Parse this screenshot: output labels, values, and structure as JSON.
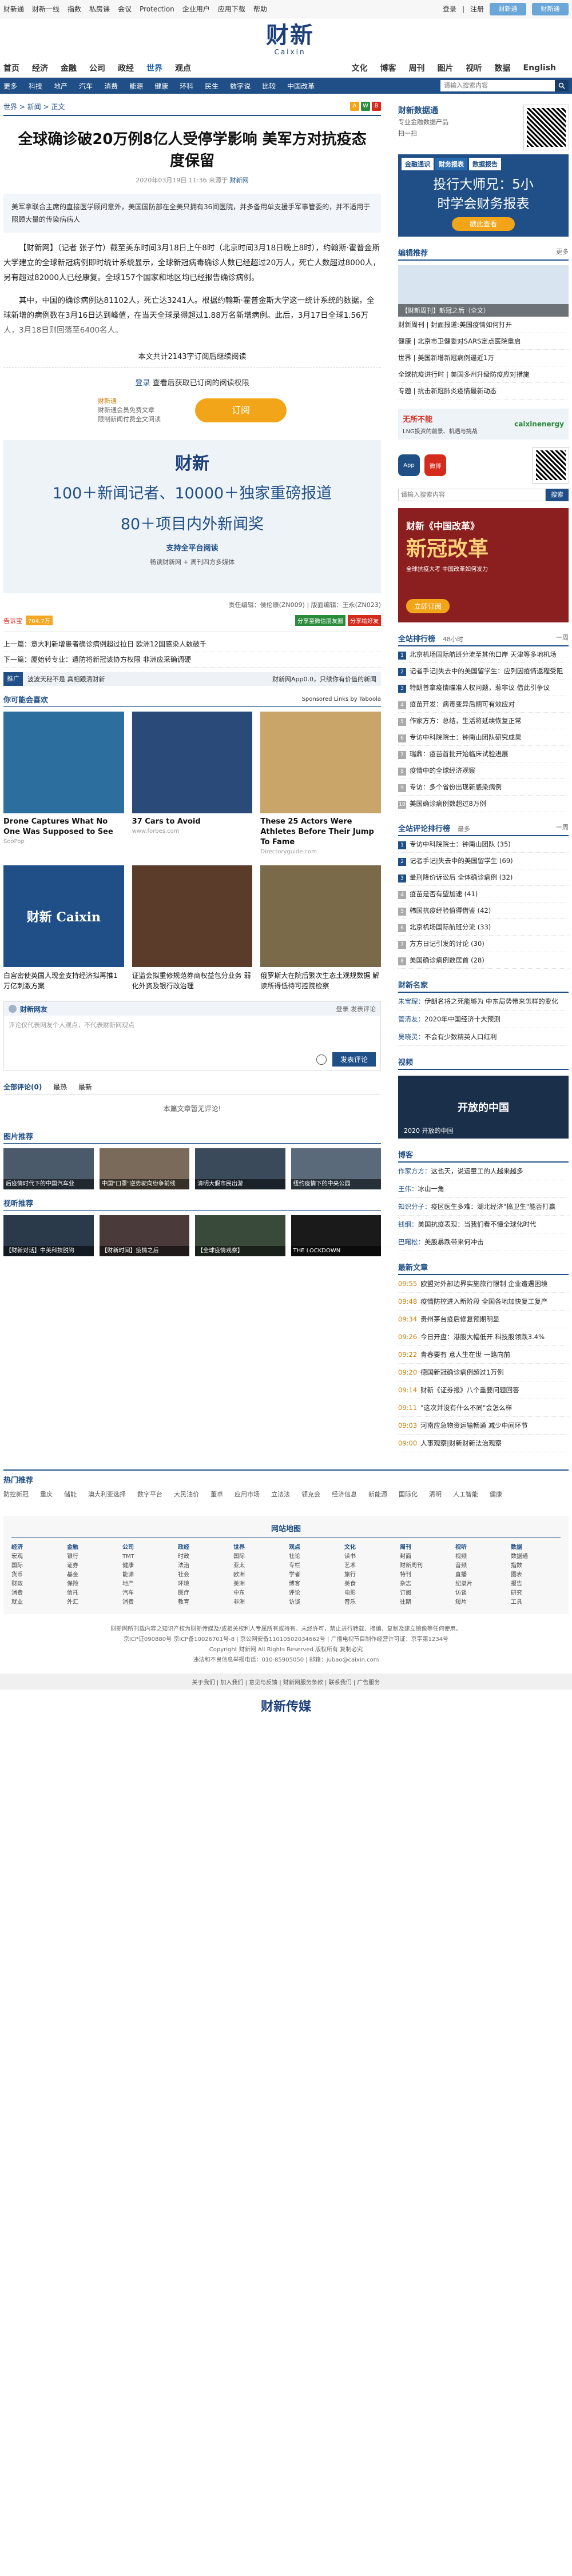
{
  "util": {
    "left": [
      "财新通",
      "财新一线",
      "指数",
      "私房课",
      "会议",
      "Protection",
      "企业用户",
      "应用下载",
      "帮助"
    ],
    "login": "登录",
    "register": "注册",
    "btn1": "财新通",
    "btn2": "财新通"
  },
  "logo": {
    "cn": "财新",
    "en": "Caixin"
  },
  "nav1": [
    "首页",
    "经济",
    "金融",
    "公司",
    "政经",
    "世界",
    "观点",
    "文化",
    "博客",
    "周刊",
    "图片",
    "视听",
    "数据",
    "English"
  ],
  "nav1_current": "世界",
  "nav2": [
    "更多",
    "科技",
    "地产",
    "汽车",
    "消费",
    "能源",
    "健康",
    "环科",
    "民生",
    "数字说",
    "比较",
    "中国改革"
  ],
  "search_placeholder": "请输入搜索内容",
  "crumb": "世界 > 新闻 > 正文",
  "title": "全球确诊破20万例8亿人受停学影响 美军方对抗疫态度保留",
  "meta": {
    "date": "2020年03月19日 11:36 来源于",
    "source": "财新网"
  },
  "summary": "美军拿联合主席的直接医学顾问意外，美国国防部在全美只拥有36间医院，并多备用单支援手军事管委的，并不适用于照顾大量的传染病病人",
  "body": [
    "【财新网】（记者 张子竹）截至美东时间3月18日上午8时（北京时间3月18日晚上8时），约翰斯·霍普金斯大学建立的全球新冠病例即时统计系统显示，全球新冠病毒确诊人数已经超过20万人，死亡人数超过8000人，另有超过82000人已经康复。全球157个国家和地区均已经报告确诊病例。",
    "其中，中国的确诊病例达81102人，死亡达3241人。根据约翰斯·霍普金斯大学这一统计系统的数据，全球新增的病例数在3月16日达到峰值，在当天全球录得超过1.88万名新增病例。此后，3月17日全球1.56万人，3月18日则回落至6400名人。"
  ],
  "sub_note": "本文共计2143字订阅后继续阅读",
  "login_line": {
    "link": "登录",
    "text": "查看后获取已订阅的阅读权限"
  },
  "sub_text": {
    "l1": "财新通会员免费文章",
    "l2": "限制新闻付费全文阅读",
    "em": "财新通"
  },
  "sub_button": "订阅",
  "promo": {
    "logo": "财新",
    "l1a": "100＋新闻记者、10000＋独家重磅报道",
    "l1b": "80＋项目内外新闻奖",
    "l2": "支持全平台阅读",
    "l3": "畅读财新网 + 周刊四方多媒体"
  },
  "editors": "责任编辑：侯伦康(ZN009) | 版面编辑：王永(ZN023)",
  "share": {
    "weibo": "告诉宝",
    "count": "704.7万",
    "b1": "分享至微信朋友圈",
    "b2": "分享给好友"
  },
  "prev": {
    "label": "上一篇：",
    "text": "意大利新增患者确诊病例超过拉日 欧洲12国感染人数破千"
  },
  "next": {
    "label": "下一篇：",
    "text": "厦始转专业：遣防将新冠该协方权限 非洲应采确调硬"
  },
  "adline": {
    "tag": "推广",
    "text": "波波天秘不是 真相跟清财新",
    "right": "财新网App0.0，只续你有价值的新闻"
  },
  "taboola": {
    "header": "你可能会喜欢",
    "right": "Sponsored Links by Taboola",
    "cards": [
      {
        "title": "Drone Captures What No One Was Supposed to See",
        "src": "SooPop",
        "bg": "#2c6e9e",
        "txt": ""
      },
      {
        "title": "37 Cars to Avoid",
        "src": "www.forbes.com",
        "bg": "#2a4b7a",
        "txt": ""
      },
      {
        "title": "These 25 Actors Were Athletes Before Their Jump To Fame",
        "src": "Directoryguide.com",
        "bg": "#c9a56a",
        "txt": ""
      },
      {
        "title": "白宫密使英国人现金支持经济拟再推1万亿刺激方案",
        "src": "",
        "bg": "#1f4f86",
        "txt": "财新 Caixin"
      },
      {
        "title": "证监会拟重修规范券商权益包分业务 弱化外资及银行改治理",
        "src": "",
        "bg": "#5b3b2a",
        "txt": ""
      },
      {
        "title": "俄罗斯大在院后繁次生态土观规数据 解读所得低待可控院检察",
        "src": "",
        "bg": "#7a6a4a",
        "txt": ""
      }
    ]
  },
  "comment": {
    "head": "财新网友",
    "login": "登录 发表评论",
    "placeholder": "评论仅代表网友个人观点，不代表财新网观点",
    "send": "发表评论",
    "tabs": [
      "全部评论(0)",
      "最热",
      "最新"
    ],
    "empty": "本篇文章暂无评论!"
  },
  "pic_recommend": {
    "header": "图片推荐",
    "items": [
      {
        "cap": "后疫情时代下的中国汽车业",
        "bg": "#4a5a6a"
      },
      {
        "cap": "中国\"口罩\"逆势驶向纷争前线",
        "bg": "#7a6a5a"
      },
      {
        "cap": "清明大假市民出游",
        "bg": "#3a4a5a"
      },
      {
        "cap": "纽约疫情下的中央公园",
        "bg": "#5a6a7a"
      }
    ]
  },
  "video_recommend": {
    "header": "视听推荐",
    "items": [
      {
        "cap": "【财新对话】中美科技脱钩",
        "bg": "#2a3a4a"
      },
      {
        "cap": "【财新时间】疫情之后",
        "bg": "#4a3a3a"
      },
      {
        "cap": "【全球疫情观察】",
        "bg": "#3a4a3a"
      },
      {
        "cap": "THE LOCKDOWN",
        "bg": "#1a1a1a"
      }
    ]
  },
  "side": {
    "top_ad": {
      "t1": "财新数据通",
      "t2": "专业金融数据产品",
      "qr_note": "扫一扫"
    },
    "tabs": [
      "金融通识",
      "财务报表",
      "数据报告"
    ],
    "tab_current": "财务报表",
    "big1": "投行大师兄：5小",
    "big2": "时学会财务报表",
    "cta": "戳此查看",
    "editor_pick": {
      "header": "编辑推荐",
      "more": "更多",
      "feat": "【财新周刊】新冠之后（全文）",
      "items": [
        "财新周刊 | 封面报道:美国疫情如何打开",
        "健康 | 北京市卫健委对SARS定点医院重启",
        "世界 | 美国新增新冠病例逼近1万",
        "全球抗疫进行时 | 美国多州升级防疫应对措施",
        "专题 | 抗击新冠肺炎疫情最新动态"
      ]
    },
    "partner": {
      "x": "无所不能",
      "y": "caixinenergy",
      "z": "LNG投资的前景、机遇与挑战"
    },
    "apps": [
      "App",
      "微博"
    ],
    "search_placeholder": "请输入搜索内容",
    "search_btn": "搜索",
    "big_ad": {
      "t1": "财新《中国改革》",
      "t2": "新冠改革",
      "t3": "全球抗疫大考 中国改革如何发力",
      "cta": "立即订阅"
    },
    "rank48": {
      "header": "全站排行榜",
      "sub": "48小时",
      "right": "一周",
      "items": [
        "北京机场国际航班分流至其他口岸 天津等多地机场",
        "记者手记|失去中的美国留学生：应列因疫情返程受阻",
        "特朗普拿疫情瞄准人权问题，惹非议 借此引争议",
        "疫苗开发：病毒变异后期可有效应对",
        "作家方方：总结，生活将延续恢复正常",
        "专访中科院院士：钟南山团队研究成果",
        "瑞鼎：疫苗首批开始临床试验进展",
        "疫情中的全球经济观察",
        "专访：多个省份出现新感染病例",
        "美国确诊病例数超过8万例"
      ]
    },
    "rank_comment": {
      "header": "全站评论排行榜",
      "sub": "最多",
      "right": "一周",
      "items": [
        "专访中科院院士：钟南山团队 (35)",
        "记者手记|失去中的美国留学生 (69)",
        "量刑降价诉讼后 全体确诊病例 (32)",
        "疫苗是否有望加速 (41)",
        "韩国抗疫经验值得借鉴 (42)",
        "北京机场国际航班分流 (33)",
        "方方日记引发的讨论 (30)",
        "美国确诊病例数居首 (28)"
      ]
    },
    "caixin_bloggers": {
      "header": "财新名家",
      "items": [
        {
          "name": "朱宝琛：",
          "text": "伊朗名将之死能够为 中东局势带来怎样的变化"
        },
        {
          "name": "管清友：",
          "text": "2020年中国经济十大预测"
        },
        {
          "name": "吴晓灵：",
          "text": "不会有少数精英人口红利"
        }
      ]
    },
    "video": {
      "header": "视频",
      "title": "开放的中国",
      "sub": "2020 开放的中国"
    },
    "blog": {
      "header": "博客",
      "items": [
        {
          "name": "作家方方：",
          "text": "这也天，说运童工的人越来越多"
        },
        {
          "name": "王伟：",
          "text": "冰山一角"
        },
        {
          "name": "知识分子：",
          "text": "疫区医生多难：湖北经济\"搞卫生\"能否打赢"
        },
        {
          "name": "钱纲：",
          "text": "美国抗疫表现：当我们看不懂全球化时代"
        },
        {
          "name": "巴曙松：",
          "text": "美股暴跌带来何冲击"
        }
      ]
    },
    "latest": {
      "header": "最新文章",
      "items": [
        {
          "t": "09:55",
          "x": "欧盟对外部边界实施旅行限制 企业遭遇困境"
        },
        {
          "t": "09:48",
          "x": "疫情防控进入新阶段 全国各地加快复工复产"
        },
        {
          "t": "09:34",
          "x": "贵州茅台疫后修复预期明显"
        },
        {
          "t": "09:26",
          "x": "今日开盘：港股大幅低开 科技股领跌3.4%"
        },
        {
          "t": "09:22",
          "x": "青春要有 意人生在世 一路向前"
        },
        {
          "t": "09:20",
          "x": "德国新冠确诊病例超过1万例"
        },
        {
          "t": "09:14",
          "x": "财新《证券报》八个重要问题回答"
        },
        {
          "t": "09:11",
          "x": "\"这次并没有什么不同\"会怎么样"
        },
        {
          "t": "09:03",
          "x": "河南应急物资运输畅通 减少中间环节"
        },
        {
          "t": "09:00",
          "x": "人事观察|财新财新法治观察"
        }
      ]
    }
  },
  "hot": {
    "header": "热门推荐",
    "tags": [
      "防控新冠",
      "重庆",
      "储能",
      "澳大利亚选择",
      "数字平台",
      "大民油价",
      "董卓",
      "应用市场",
      "立法法",
      "领克会",
      "经济信息",
      "新能源",
      "国际化",
      "清明",
      "人工智能",
      "健康"
    ]
  },
  "sitemap": {
    "header": "网站地图",
    "cols": [
      {
        "h": "经济",
        "items": [
          "宏观",
          "国际",
          "货币",
          "财政",
          "消费",
          "就业"
        ]
      },
      {
        "h": "金融",
        "items": [
          "银行",
          "证券",
          "基金",
          "保险",
          "信托",
          "外汇"
        ]
      },
      {
        "h": "公司",
        "items": [
          "TMT",
          "健康",
          "能源",
          "地产",
          "汽车",
          "消费"
        ]
      },
      {
        "h": "政经",
        "items": [
          "时政",
          "法治",
          "社会",
          "环境",
          "医疗",
          "教育"
        ]
      },
      {
        "h": "世界",
        "items": [
          "国际",
          "亚太",
          "欧洲",
          "美洲",
          "中东",
          "非洲"
        ]
      },
      {
        "h": "观点",
        "items": [
          "社论",
          "专栏",
          "学者",
          "博客",
          "评论",
          "访谈"
        ]
      },
      {
        "h": "文化",
        "items": [
          "读书",
          "艺术",
          "旅行",
          "美食",
          "电影",
          "音乐"
        ]
      },
      {
        "h": "周刊",
        "items": [
          "封面",
          "财新周刊",
          "特刊",
          "杂志",
          "订阅",
          "往期"
        ]
      },
      {
        "h": "视听",
        "items": [
          "视频",
          "音频",
          "直播",
          "纪录片",
          "访谈",
          "短片"
        ]
      },
      {
        "h": "数据",
        "items": [
          "数据通",
          "指数",
          "图表",
          "报告",
          "研究",
          "工具"
        ]
      }
    ]
  },
  "footer": [
    "财新网所刊载内容之知识产权为财新传媒及/或相关权利人专属所有或持有。未经许可，禁止进行转载、摘编、复制及建立镜像等任何使用。",
    "京ICP证090880号 京ICP备10026701号-8 | 京公网安备11010502034662号 | 广播电视节目制作经营许可证：京字第1234号",
    "Copyright 财新网 All Rights Reserved 版权所有 复制必究",
    "违法和不良信息举报电话：010-85905050 | 邮箱：jubao@caixin.com"
  ],
  "bottom_bar": "关于我们 | 加入我们 | 意见与反馈 | 财新网服务条款 | 联系我们 | 广告服务",
  "bottom_logo": "财新传媒"
}
